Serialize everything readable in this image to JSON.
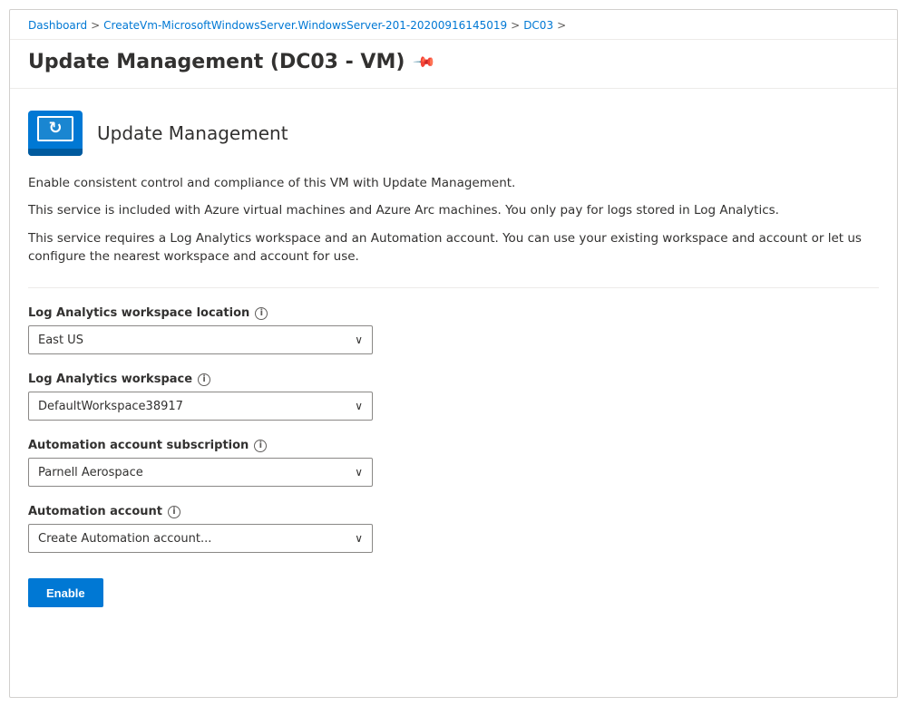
{
  "breadcrumb": {
    "items": [
      {
        "label": "Dashboard",
        "link": true
      },
      {
        "label": "CreateVm-MicrosoftWindowsServer.WindowsServer-201-20200916145019",
        "link": true
      },
      {
        "label": "DC03",
        "link": true
      }
    ]
  },
  "header": {
    "title": "Update Management (DC03 - VM)",
    "pin_label": "📌"
  },
  "service": {
    "icon_alt": "Update Management icon",
    "title": "Update Management"
  },
  "descriptions": {
    "line1": "Enable consistent control and compliance of this VM with Update Management.",
    "line2": "This service is included with Azure virtual machines and Azure Arc machines. You only pay for logs stored in Log Analytics.",
    "line3": "This service requires a Log Analytics workspace and an Automation account. You can use your existing workspace and account or let us configure the nearest workspace and account for use."
  },
  "form": {
    "workspace_location": {
      "label": "Log Analytics workspace location",
      "value": "East US"
    },
    "workspace": {
      "label": "Log Analytics workspace",
      "value": "DefaultWorkspace38917"
    },
    "automation_subscription": {
      "label": "Automation account subscription",
      "value": "Parnell Aerospace"
    },
    "automation_account": {
      "label": "Automation account",
      "value": "Create Automation account..."
    }
  },
  "buttons": {
    "enable": "Enable"
  }
}
